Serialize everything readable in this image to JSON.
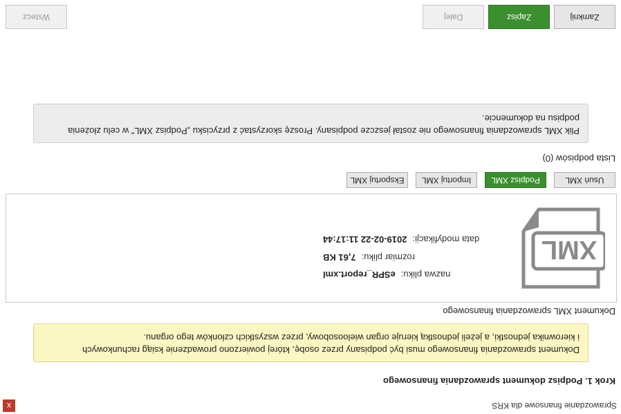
{
  "window": {
    "title": "Sprawozdanie finansowe dla KRS",
    "close_glyph": "x"
  },
  "step": {
    "title": "Krok 1. Podpisz dokument sprawozdania finansowego"
  },
  "notice_yellow": {
    "line1": "Dokument sprawozdania finansowego musi być podpisany przez osobę, której powierzono prowadzenie ksiąg rachunkowych",
    "line2": "i kierownika jednostki, a jeżeli jednostką kieruje organ wieloosobowy, przez wszystkich członków tego organu."
  },
  "xml_doc": {
    "section_label": "Dokument XML sprawozdania finansowego",
    "icon_label": "XML",
    "file_name_label": "nazwa pliku:",
    "file_name": "eSPR_report.xml",
    "file_size_label": "rozmiar pliku:",
    "file_size": "7,61 KB",
    "modified_label": "data modyfikacji:",
    "modified": "2019-02-22 11:17:44"
  },
  "xml_actions": {
    "delete": "Usuń XML",
    "sign": "Podpisz XML",
    "import": "Importuj XML",
    "export": "Eksportuj XML"
  },
  "signatures": {
    "section_label": "Lista podpisów (0)"
  },
  "notice_grey": {
    "line1": "Plik XML sprawozdania finansowego nie został jeszcze podpisany. Proszę skorzystać z przycisku „Podpisz XML” w celu złożenia",
    "line2": "podpisu na dokumencie."
  },
  "footer": {
    "back": "Wstecz",
    "next": "Dalej",
    "save": "Zapisz",
    "close": "Zamknij"
  },
  "colors": {
    "accent_green": "#3c8f2f",
    "close_red": "#c0392b",
    "notice_yellow": "#fbf7c3"
  }
}
